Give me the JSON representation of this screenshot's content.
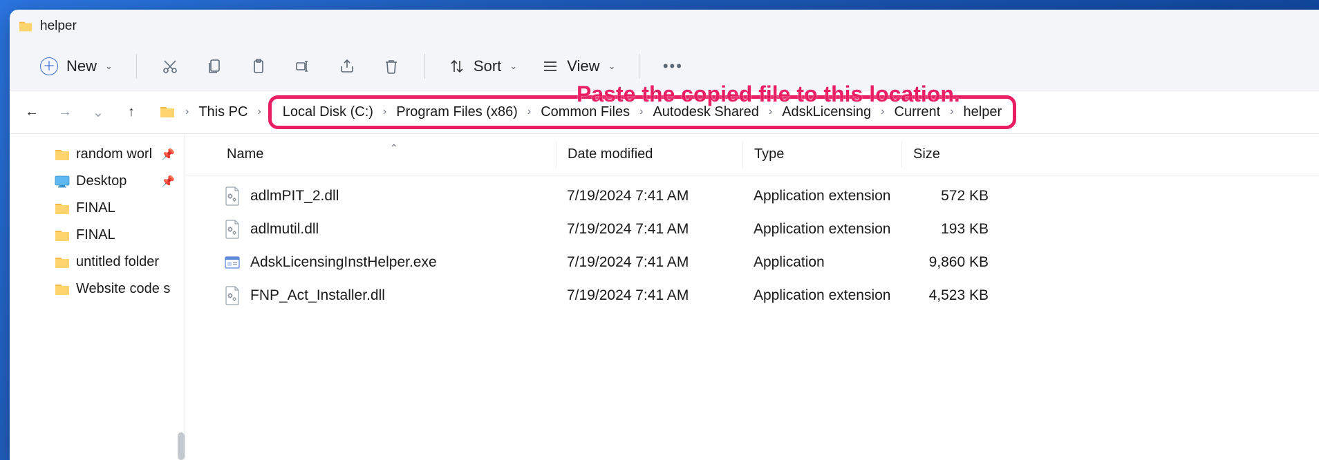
{
  "window": {
    "title": "helper"
  },
  "toolbar": {
    "new_label": "New",
    "sort_label": "Sort",
    "view_label": "View"
  },
  "annotation": "Paste the copied file to this location.",
  "breadcrumb": {
    "root": "This PC",
    "items": [
      "Local Disk (C:)",
      "Program Files (x86)",
      "Common Files",
      "Autodesk Shared",
      "AdskLicensing",
      "Current",
      "helper"
    ]
  },
  "sidebar": {
    "items": [
      {
        "label": "random worl",
        "kind": "folder",
        "pinned": true
      },
      {
        "label": "Desktop",
        "kind": "desktop",
        "pinned": true
      },
      {
        "label": "FINAL",
        "kind": "folder",
        "pinned": false
      },
      {
        "label": "FINAL",
        "kind": "folder",
        "pinned": false
      },
      {
        "label": "untitled folder",
        "kind": "folder",
        "pinned": false
      },
      {
        "label": "Website code s",
        "kind": "folder",
        "pinned": false
      }
    ]
  },
  "columns": {
    "name": "Name",
    "modified": "Date modified",
    "type": "Type",
    "size": "Size"
  },
  "files": [
    {
      "name": "adlmPIT_2.dll",
      "modified": "7/19/2024 7:41 AM",
      "type": "Application extension",
      "size": "572 KB",
      "icon": "dll"
    },
    {
      "name": "adlmutil.dll",
      "modified": "7/19/2024 7:41 AM",
      "type": "Application extension",
      "size": "193 KB",
      "icon": "dll"
    },
    {
      "name": "AdskLicensingInstHelper.exe",
      "modified": "7/19/2024 7:41 AM",
      "type": "Application",
      "size": "9,860 KB",
      "icon": "exe"
    },
    {
      "name": "FNP_Act_Installer.dll",
      "modified": "7/19/2024 7:41 AM",
      "type": "Application extension",
      "size": "4,523 KB",
      "icon": "dll"
    }
  ]
}
